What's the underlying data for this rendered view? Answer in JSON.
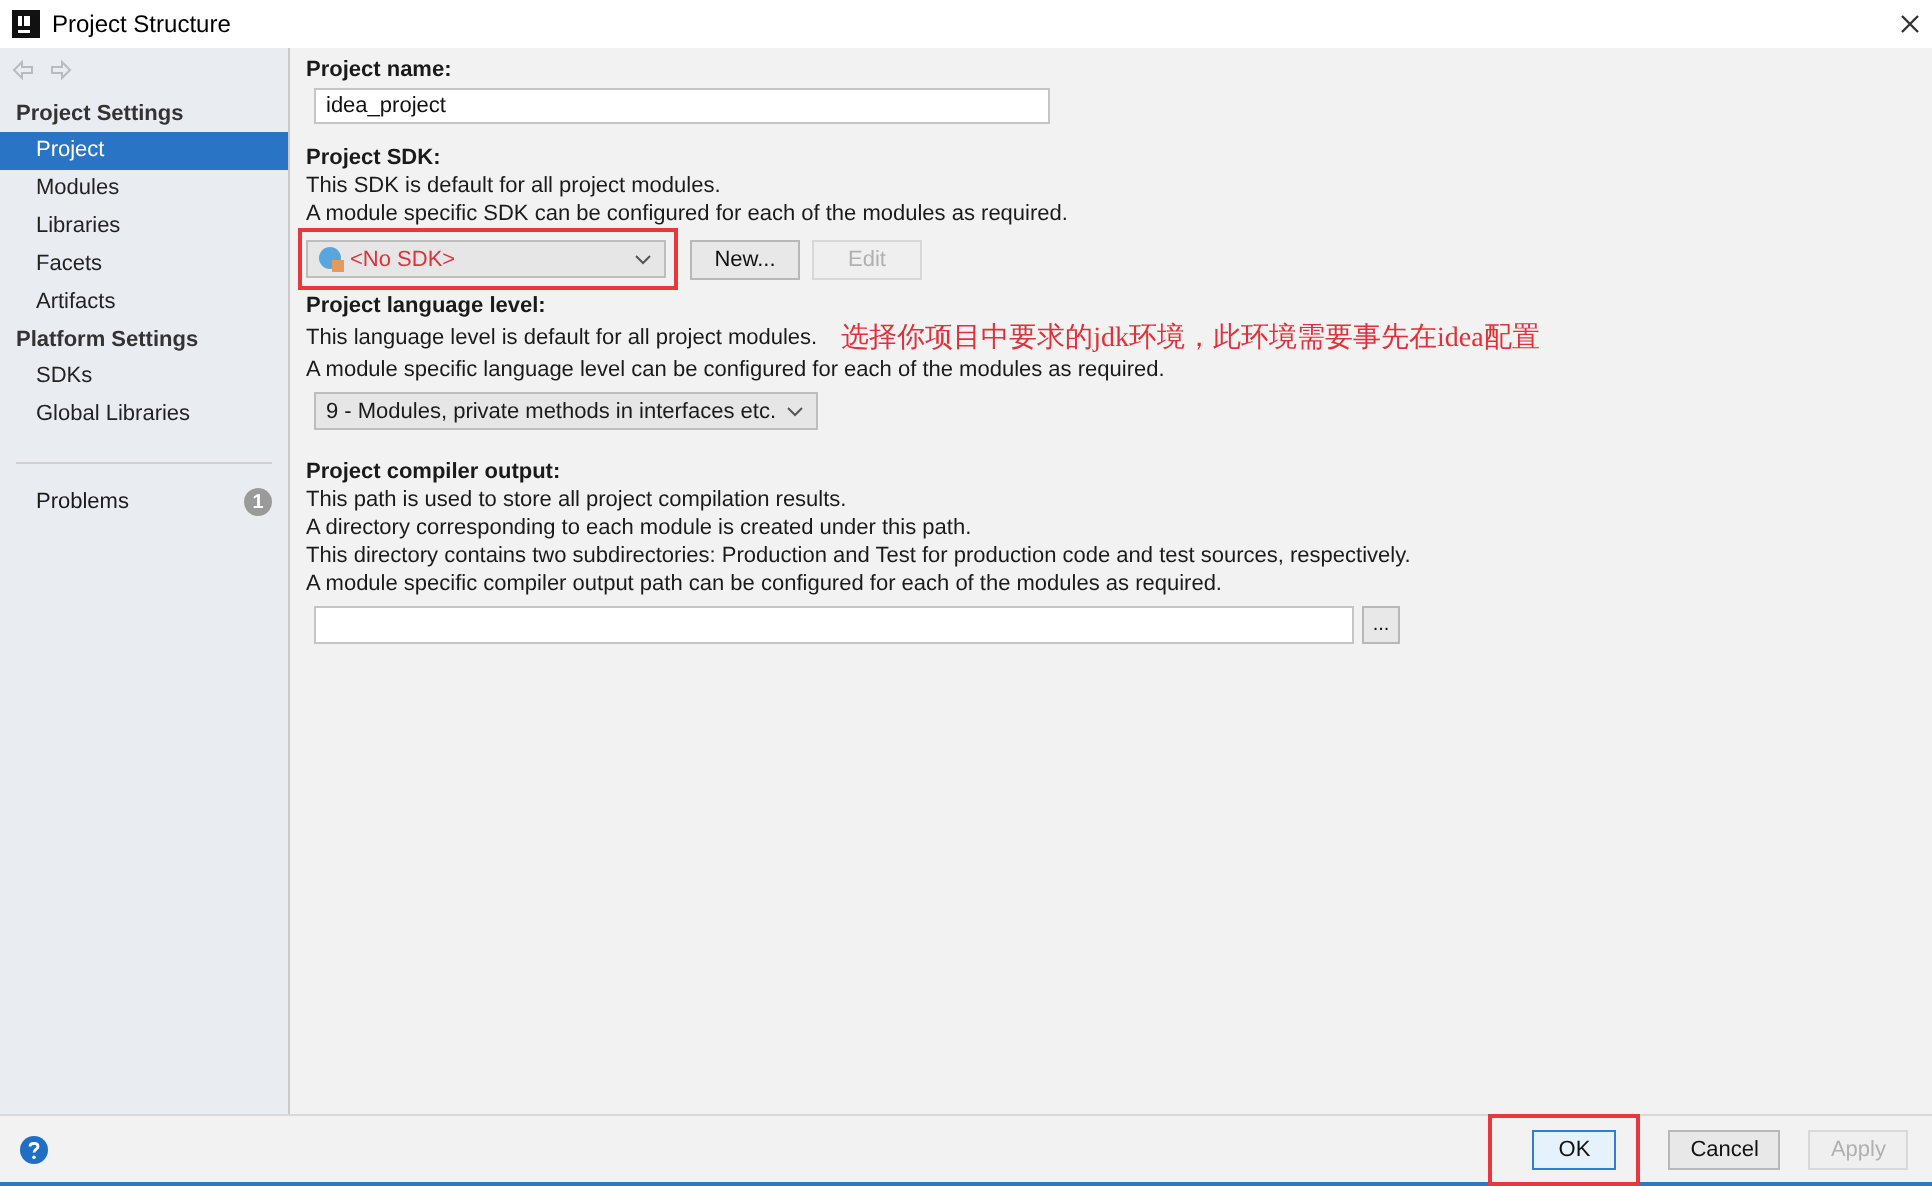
{
  "window": {
    "title": "Project Structure"
  },
  "sidebar": {
    "groups": [
      {
        "title": "Project Settings",
        "items": [
          {
            "label": "Project",
            "selected": true
          },
          {
            "label": "Modules",
            "selected": false
          },
          {
            "label": "Libraries",
            "selected": false
          },
          {
            "label": "Facets",
            "selected": false
          },
          {
            "label": "Artifacts",
            "selected": false
          }
        ]
      },
      {
        "title": "Platform Settings",
        "items": [
          {
            "label": "SDKs",
            "selected": false
          },
          {
            "label": "Global Libraries",
            "selected": false
          }
        ]
      }
    ],
    "problems": {
      "label": "Problems",
      "count": "1"
    }
  },
  "project_name": {
    "label": "Project name:",
    "value": "idea_project"
  },
  "project_sdk": {
    "label": "Project SDK:",
    "lines": [
      "This SDK is default for all project modules.",
      "A module specific SDK can be configured for each of the modules as required."
    ],
    "value": "<No SDK>",
    "highlighted": true,
    "buttons": [
      {
        "label": "New...",
        "disabled": false
      },
      {
        "label": "Edit",
        "disabled": true
      }
    ]
  },
  "language_level": {
    "label": "Project language level:",
    "lines": [
      "This language level is default for all project modules.",
      "A module specific language level can be configured for each of the modules as required."
    ],
    "value": "9 - Modules, private methods in interfaces etc."
  },
  "annotation": "选择你项目中要求的jdk环境，此环境需要事先在idea配置",
  "compiler_output": {
    "label": "Project compiler output:",
    "lines": [
      "This path is used to store all project compilation results.",
      "A directory corresponding to each module is created under this path.",
      "This directory contains two subdirectories: Production and Test for production code and test sources, respectively.",
      "A module specific compiler output path can be configured for each of the modules as required."
    ],
    "browse": "..."
  },
  "footer": {
    "buttons": [
      {
        "label": "OK",
        "disabled": false,
        "default": true,
        "highlighted": true
      },
      {
        "label": "Cancel",
        "disabled": false,
        "default": false,
        "highlighted": false
      },
      {
        "label": "Apply",
        "disabled": true,
        "default": false,
        "highlighted": false
      }
    ]
  }
}
